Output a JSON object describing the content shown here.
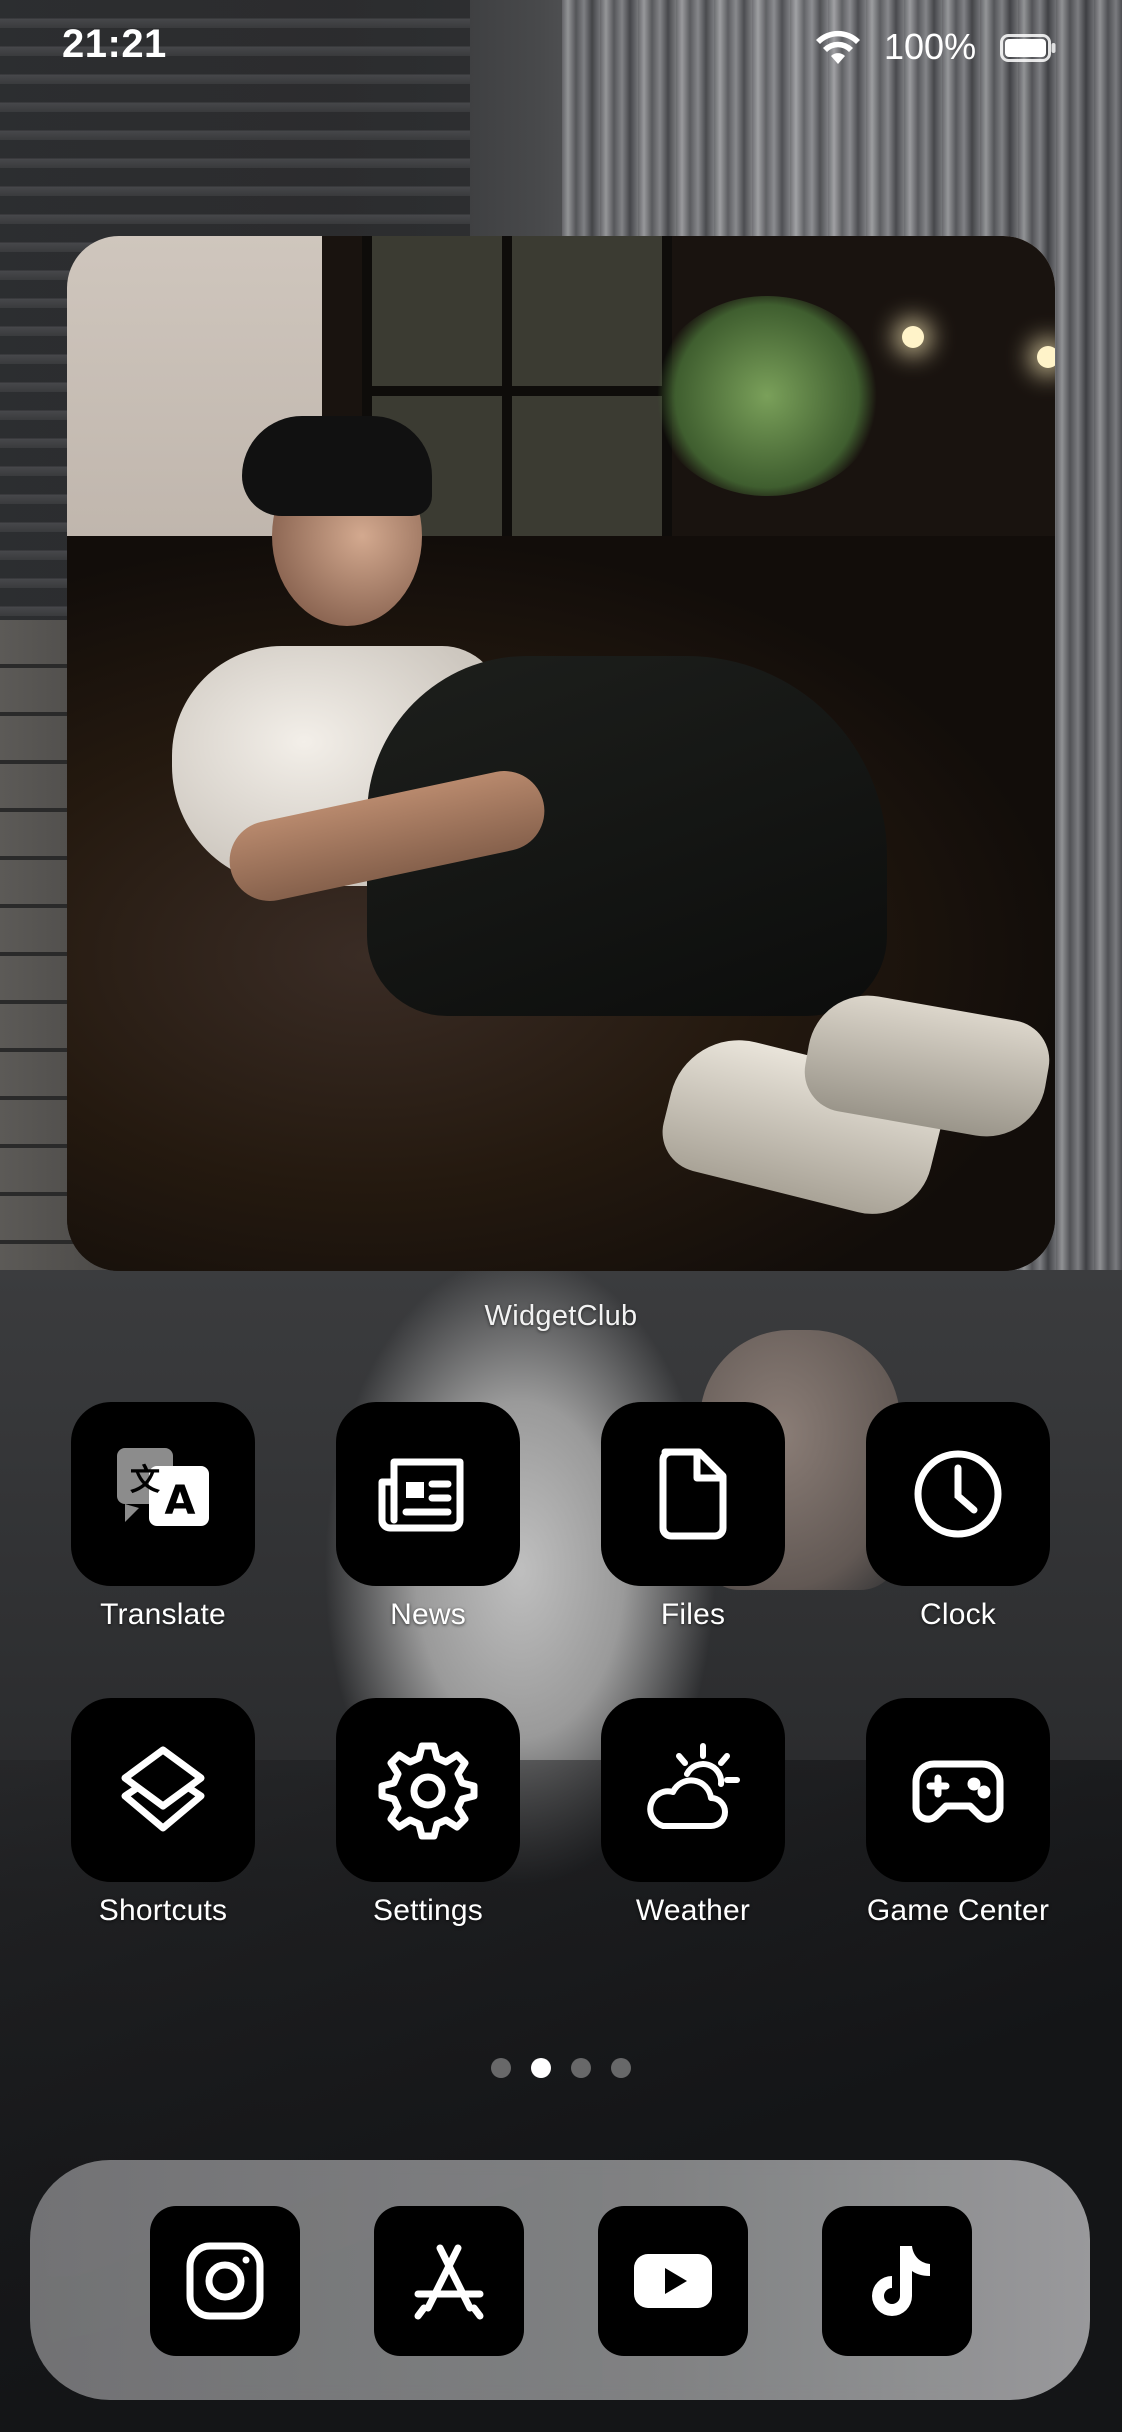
{
  "status_bar": {
    "time": "21:21",
    "battery_percent": "100%",
    "wifi_icon": "wifi-icon",
    "battery_icon": "battery-full-icon"
  },
  "widget": {
    "label": "WidgetClub",
    "content": "photo"
  },
  "apps": [
    {
      "label": "Translate",
      "icon": "translate-icon"
    },
    {
      "label": "News",
      "icon": "newspaper-icon"
    },
    {
      "label": "Files",
      "icon": "document-icon"
    },
    {
      "label": "Clock",
      "icon": "clock-icon"
    },
    {
      "label": "Shortcuts",
      "icon": "shortcuts-layers-icon"
    },
    {
      "label": "Settings",
      "icon": "gear-icon"
    },
    {
      "label": "Weather",
      "icon": "cloud-sun-icon"
    },
    {
      "label": "Game Center",
      "icon": "gamepad-icon"
    }
  ],
  "page_indicator": {
    "total_pages": 4,
    "current_page": 2
  },
  "dock": [
    {
      "icon": "instagram-icon"
    },
    {
      "icon": "app-store-icon"
    },
    {
      "icon": "youtube-icon"
    },
    {
      "icon": "tiktok-icon"
    }
  ],
  "colors": {
    "icon_tile": "#000000",
    "icon_glyph": "#ffffff",
    "label_text": "#ffffff"
  }
}
